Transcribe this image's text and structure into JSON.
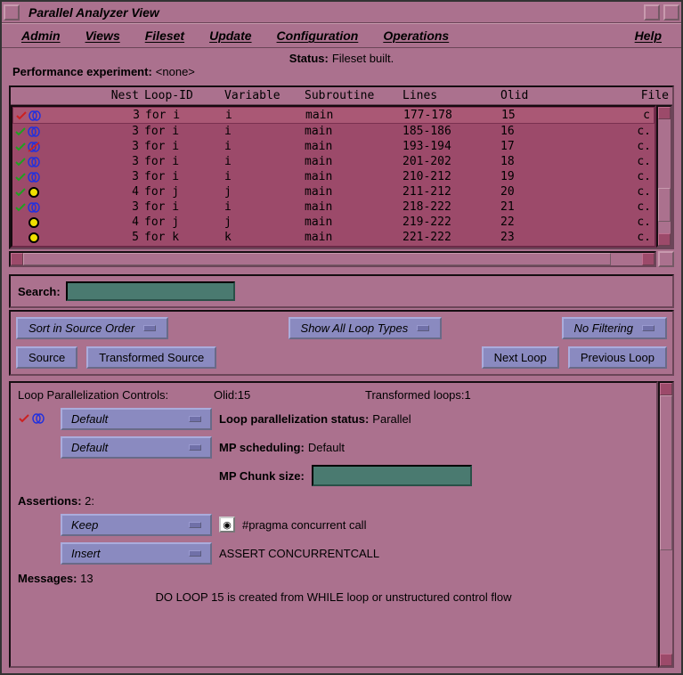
{
  "window": {
    "title": "Parallel Analyzer View"
  },
  "menus": {
    "admin": "Admin",
    "views": "Views",
    "fileset": "Fileset",
    "update": "Update",
    "configuration": "Configuration",
    "operations": "Operations",
    "help": "Help"
  },
  "status": {
    "label": "Status:",
    "value": "Fileset built.",
    "perf_label": "Performance experiment:",
    "perf_value": "<none>"
  },
  "table": {
    "headers": {
      "nest": "Nest",
      "loopid": "Loop-ID",
      "variable": "Variable",
      "subroutine": "Subroutine",
      "lines": "Lines",
      "olid": "Olid",
      "file": "File"
    },
    "rows": [
      {
        "icons": [
          "check-red",
          "rings-blue"
        ],
        "nest": "3",
        "loopid": "for i",
        "variable": "i",
        "subroutine": "main",
        "lines": "177-178",
        "olid": "15",
        "file": "c",
        "selected": true
      },
      {
        "icons": [
          "check-green",
          "rings-blue"
        ],
        "nest": "3",
        "loopid": "for i",
        "variable": "i",
        "subroutine": "main",
        "lines": "185-186",
        "olid": "16",
        "file": "c."
      },
      {
        "icons": [
          "check-green",
          "rings-strike"
        ],
        "nest": "3",
        "loopid": "for i",
        "variable": "i",
        "subroutine": "main",
        "lines": "193-194",
        "olid": "17",
        "file": "c."
      },
      {
        "icons": [
          "check-green",
          "rings-blue"
        ],
        "nest": "3",
        "loopid": "for i",
        "variable": "i",
        "subroutine": "main",
        "lines": "201-202",
        "olid": "18",
        "file": "c."
      },
      {
        "icons": [
          "check-green",
          "rings-blue"
        ],
        "nest": "3",
        "loopid": "for i",
        "variable": "i",
        "subroutine": "main",
        "lines": "210-212",
        "olid": "19",
        "file": "c."
      },
      {
        "icons": [
          "check-green",
          "ring-yellow"
        ],
        "nest": "4",
        "loopid": " for j",
        "variable": "j",
        "subroutine": "main",
        "lines": "211-212",
        "olid": "20",
        "file": "c."
      },
      {
        "icons": [
          "check-green",
          "rings-blue"
        ],
        "nest": "3",
        "loopid": "for i",
        "variable": "i",
        "subroutine": "main",
        "lines": "218-222",
        "olid": "21",
        "file": "c."
      },
      {
        "icons": [
          "",
          "ring-yellow"
        ],
        "nest": "4",
        "loopid": " for j",
        "variable": "j",
        "subroutine": "main",
        "lines": "219-222",
        "olid": "22",
        "file": "c."
      },
      {
        "icons": [
          "",
          "ring-yellow"
        ],
        "nest": "5",
        "loopid": "  for k",
        "variable": "k",
        "subroutine": "main",
        "lines": "221-222",
        "olid": "23",
        "file": "c."
      }
    ]
  },
  "search": {
    "label": "Search:",
    "value": ""
  },
  "buttons": {
    "sort": "Sort in Source Order",
    "showtypes": "Show All Loop Types",
    "nofilter": "No Filtering",
    "source": "Source",
    "transformed": "Transformed Source",
    "nextloop": "Next Loop",
    "prevloop": "Previous Loop"
  },
  "loop_panel": {
    "title": "Loop Parallelization Controls:",
    "olid": "Olid:15",
    "transformed": "Transformed loops:1",
    "par_status_btn": "Default",
    "par_status_lbl": "Loop parallelization status:",
    "par_status_val": "Parallel",
    "sched_btn": "Default",
    "sched_lbl": "MP scheduling:",
    "sched_val": "Default",
    "chunk_lbl": "MP Chunk size:",
    "chunk_val": ""
  },
  "assertions": {
    "label": "Assertions:",
    "count": "2:",
    "keep_btn": "Keep",
    "keep_text": "#pragma concurrent call",
    "insert_btn": "Insert",
    "insert_text": "ASSERT CONCURRENTCALL"
  },
  "messages": {
    "label": "Messages:",
    "count": "13",
    "text": "DO LOOP 15 is created from WHILE loop or unstructured control flow"
  }
}
